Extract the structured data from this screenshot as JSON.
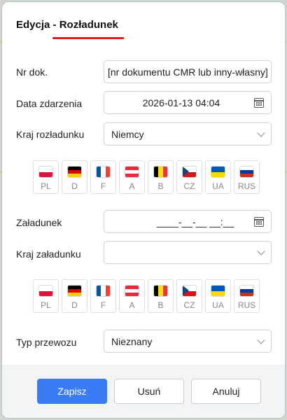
{
  "dialog": {
    "title_prefix": "Edycja - ",
    "title_main": "Rozładunek"
  },
  "form": {
    "nr_dok": {
      "label": "Nr dok.",
      "value": "[nr dokumentu CMR lub inny-własny]"
    },
    "data_zdarzenia": {
      "label": "Data zdarzenia",
      "value": "2026-01-13 04:04"
    },
    "kraj_rozladunku": {
      "label": "Kraj rozładunku",
      "value": "Niemcy"
    },
    "zaladunek": {
      "label": "Załadunek",
      "value": "____-__-__ __:__"
    },
    "kraj_zaladunku": {
      "label": "Kraj załadunku",
      "value": ""
    },
    "typ_przewozu": {
      "label": "Typ przewozu",
      "value": "Nieznany"
    }
  },
  "flags": [
    {
      "code": "PL",
      "colors": [
        "#ffffff",
        "#dc143c"
      ],
      "dir": "h"
    },
    {
      "code": "D",
      "colors": [
        "#000000",
        "#dd0000",
        "#ffce00"
      ],
      "dir": "h"
    },
    {
      "code": "F",
      "colors": [
        "#0055a4",
        "#ffffff",
        "#ef4135"
      ],
      "dir": "v"
    },
    {
      "code": "A",
      "colors": [
        "#ed2939",
        "#ffffff",
        "#ed2939"
      ],
      "dir": "h"
    },
    {
      "code": "B",
      "colors": [
        "#000000",
        "#fdda24",
        "#ef3340"
      ],
      "dir": "v"
    },
    {
      "code": "CZ",
      "colors": [
        "#ffffff",
        "#d7141a"
      ],
      "dir": "h",
      "triangle": "#11457e"
    },
    {
      "code": "UA",
      "colors": [
        "#0057b7",
        "#ffd700"
      ],
      "dir": "h"
    },
    {
      "code": "RUS",
      "colors": [
        "#ffffff",
        "#0039a6",
        "#d52b1e"
      ],
      "dir": "h"
    }
  ],
  "buttons": {
    "save": "Zapisz",
    "delete": "Usuń",
    "cancel": "Anuluj"
  },
  "colors": {
    "accent": "#3b7cf5",
    "title_underline": "#e02020"
  }
}
